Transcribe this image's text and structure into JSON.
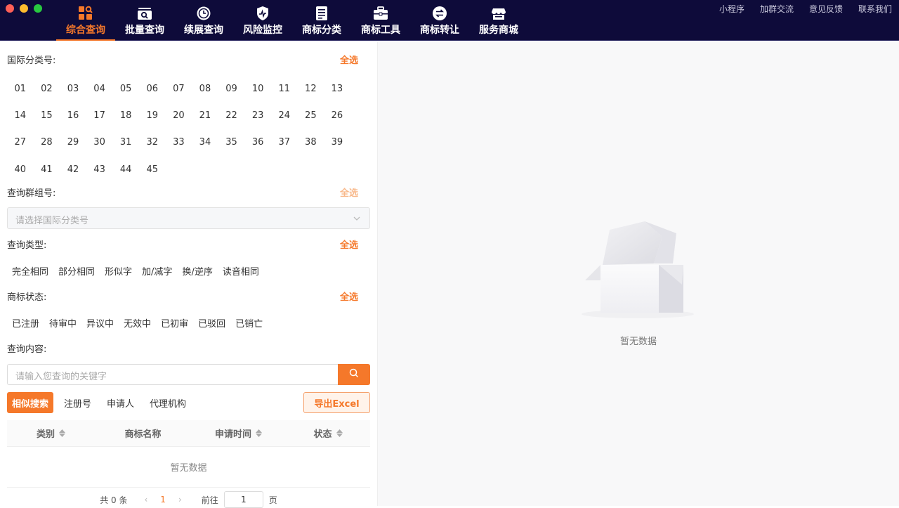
{
  "nav": {
    "items": [
      {
        "label": "综合查询",
        "icon": "grid-search-icon"
      },
      {
        "label": "批量查询",
        "icon": "batch-search-icon"
      },
      {
        "label": "续展查询",
        "icon": "clock-renew-icon"
      },
      {
        "label": "风险监控",
        "icon": "shield-pulse-icon"
      },
      {
        "label": "商标分类",
        "icon": "document-list-icon"
      },
      {
        "label": "商标工具",
        "icon": "toolbox-icon"
      },
      {
        "label": "商标转让",
        "icon": "transfer-icon"
      },
      {
        "label": "服务商城",
        "icon": "store-icon"
      }
    ],
    "active_index": 0
  },
  "top_links": {
    "mini_program": "小程序",
    "join_group": "加群交流",
    "feedback": "意见反馈",
    "contact": "联系我们"
  },
  "filters": {
    "intl_class": {
      "title": "国际分类号:",
      "select_all": "全选",
      "codes": [
        "01",
        "02",
        "03",
        "04",
        "05",
        "06",
        "07",
        "08",
        "09",
        "10",
        "11",
        "12",
        "13",
        "14",
        "15",
        "16",
        "17",
        "18",
        "19",
        "20",
        "21",
        "22",
        "23",
        "24",
        "25",
        "26",
        "27",
        "28",
        "29",
        "30",
        "31",
        "32",
        "33",
        "34",
        "35",
        "36",
        "37",
        "38",
        "39",
        "40",
        "41",
        "42",
        "43",
        "44",
        "45"
      ]
    },
    "group": {
      "title": "查询群组号:",
      "select_all": "全选",
      "placeholder": "请选择国际分类号"
    },
    "query_type": {
      "title": "查询类型:",
      "select_all": "全选",
      "options": [
        "完全相同",
        "部分相同",
        "形似字",
        "加/减字",
        "换/逆序",
        "读音相同"
      ]
    },
    "status": {
      "title": "商标状态:",
      "select_all": "全选",
      "options": [
        "已注册",
        "待审中",
        "异议中",
        "无效中",
        "已初审",
        "已驳回",
        "已销亡"
      ]
    },
    "content": {
      "title": "查询内容:",
      "placeholder": "请输入您查询的关键字"
    }
  },
  "search_modes": {
    "tabs": [
      "相似搜索",
      "注册号",
      "申请人",
      "代理机构"
    ],
    "active_index": 0,
    "export_label": "导出Excel"
  },
  "table": {
    "columns": [
      "类别",
      "商标名称",
      "申请时间",
      "状态"
    ],
    "empty_text": "暂无数据"
  },
  "pager": {
    "total": "共 0 条",
    "current": "1",
    "goto_label": "前往",
    "page_value": "1",
    "page_unit": "页"
  },
  "right_panel": {
    "empty_text": "暂无数据"
  },
  "colors": {
    "accent": "#f5782a",
    "topbar": "#0e0b3a"
  }
}
